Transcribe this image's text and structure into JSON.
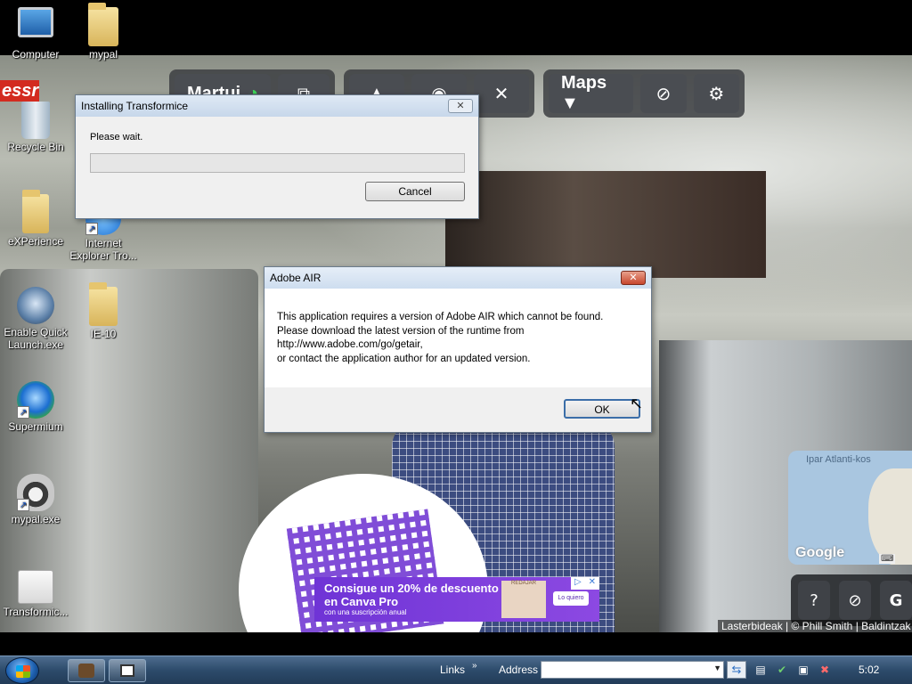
{
  "desktop": {
    "icons": [
      {
        "label": "Computer"
      },
      {
        "label": "mypal"
      },
      {
        "label": "Recycle Bin"
      },
      {
        "label": "eXPerience"
      },
      {
        "label": "Internet Explorer Tro..."
      },
      {
        "label": "Enable Quick Launch.exe"
      },
      {
        "label": "IE-10"
      },
      {
        "label": "Supermium"
      },
      {
        "label": "mypal.exe"
      },
      {
        "label": "Transformic..."
      }
    ],
    "corner_logo": "essr"
  },
  "map_app": {
    "toolbar": {
      "user_label": "Martui",
      "maps_label": "Maps ▼"
    },
    "minimap": {
      "ocean_label": "Ipar Atlanti-kos",
      "provider": "Google"
    },
    "bottom_tools": {
      "help_label": "?",
      "more_label": "G"
    },
    "credits": "Lasterbideak | © Phill Smith | Baldintzak"
  },
  "ad": {
    "headline": "Consigue un 20% de descuento en Canva Pro",
    "sub": "con una suscripción anual",
    "cta": "Lo quiero",
    "badge": "REDAJAR"
  },
  "installer_dialog": {
    "title": "Installing Transformice",
    "message": "Please wait.",
    "progress": 0,
    "cancel_label": "Cancel"
  },
  "air_dialog": {
    "title": "Adobe AIR",
    "lines": [
      "This application requires a version of Adobe AIR which cannot be found.",
      "Please download the latest version of the runtime from",
      "http://www.adobe.com/go/getair,",
      "or contact the application author for an updated version."
    ],
    "ok_label": "OK"
  },
  "taskbar": {
    "links_label": "Links",
    "address_label": "Address",
    "address_value": "",
    "clock": "5:02"
  }
}
